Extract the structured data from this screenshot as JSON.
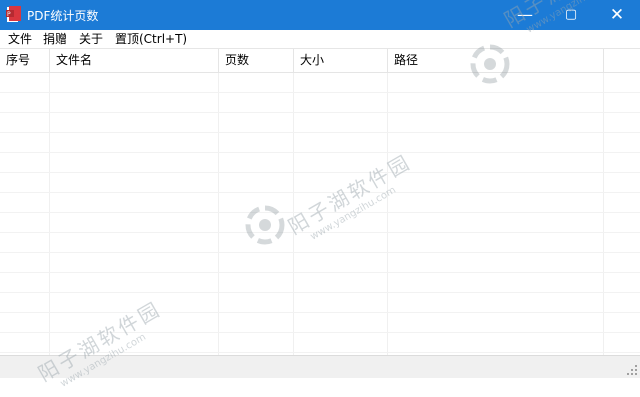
{
  "window": {
    "title": "PDF统计页数",
    "controls": {
      "minimize": "—",
      "maximize": "▢",
      "close": "✕"
    }
  },
  "menu": {
    "items": [
      {
        "label": "文件"
      },
      {
        "label": "捐赠"
      },
      {
        "label": "关于"
      },
      {
        "label": "置顶(Ctrl+T)"
      }
    ]
  },
  "table": {
    "columns": [
      {
        "label": "序号"
      },
      {
        "label": "文件名"
      },
      {
        "label": "页数"
      },
      {
        "label": "大小"
      },
      {
        "label": "路径"
      }
    ],
    "rows": []
  },
  "watermark": {
    "text": "阳子湖软件园",
    "url": "www.yangzihu.com"
  },
  "colors": {
    "titlebar": "#1c7bd6",
    "app_icon": "#d9363e"
  }
}
